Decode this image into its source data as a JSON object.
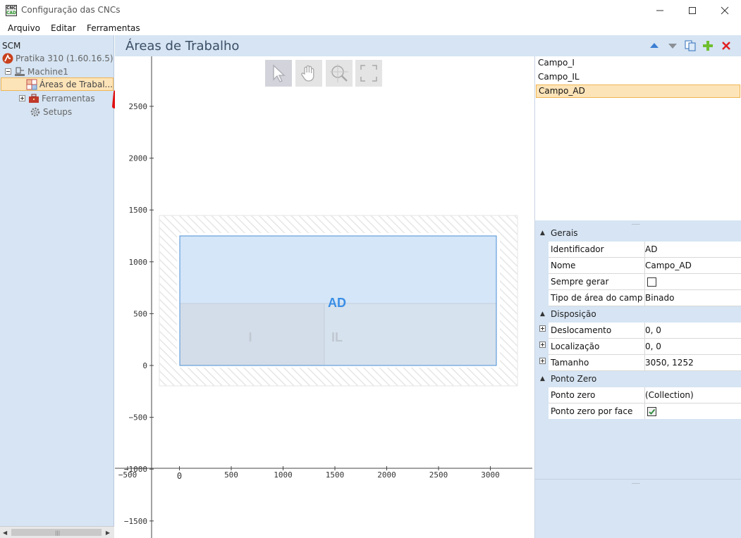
{
  "window": {
    "title": "Configuração das CNCs",
    "icon_text_top": "CNC",
    "icon_text_bottom": "CAD"
  },
  "menu": {
    "items": [
      "Arquivo",
      "Editar",
      "Ferramentas"
    ]
  },
  "tree": {
    "root": "SCM",
    "machine_model": "Pratika 310 (1.60.16.5)",
    "machine": "Machine1",
    "items": [
      {
        "label": "Áreas de Trabal...",
        "selected": true,
        "icon": "grid-icon"
      },
      {
        "label": "Ferramentas",
        "selected": false,
        "icon": "toolbox-icon"
      },
      {
        "label": "Setups",
        "selected": false,
        "icon": "gear-icon"
      }
    ]
  },
  "header": {
    "title": "Áreas de Trabalho",
    "buttons": [
      "move-up-icon",
      "move-down-icon",
      "copy-icon",
      "add-icon",
      "delete-icon"
    ]
  },
  "toolbar": {
    "tools": [
      "select-pointer-icon",
      "pan-hand-icon",
      "zoom-icon",
      "fit-view-icon"
    ],
    "active": "select-pointer-icon"
  },
  "plot": {
    "y_ticks": [
      "2500",
      "2000",
      "1500",
      "1000",
      "500",
      "0",
      "−500",
      "−1000",
      "−1500"
    ],
    "x_ticks": [
      "−500",
      "0",
      "500",
      "1000",
      "1500",
      "2000",
      "2500",
      "3000"
    ],
    "areas": {
      "main_label": "AD",
      "left_label": "I",
      "right_label": "IL"
    },
    "colors": {
      "area_fill": "#d4e6f8",
      "area_border": "#4b8fd6",
      "label_main": "#3a8ee6",
      "label_sub": "#c0c8d2"
    }
  },
  "list": {
    "items": [
      "Campo_I",
      "Campo_IL",
      "Campo_AD"
    ],
    "selected_index": 2
  },
  "properties": {
    "categories": [
      {
        "label": "Gerais",
        "rows": [
          {
            "name": "Identificador",
            "value": "AD"
          },
          {
            "name": "Nome",
            "value": "Campo_AD"
          },
          {
            "name": "Sempre gerar",
            "value": "",
            "checkbox": false
          },
          {
            "name": "Tipo de área do campo...",
            "value": "Binado"
          }
        ]
      },
      {
        "label": "Disposição",
        "rows": [
          {
            "name": "Deslocamento",
            "value": "0, 0",
            "expandable": true
          },
          {
            "name": "Localização",
            "value": "0, 0",
            "expandable": true
          },
          {
            "name": "Tamanho",
            "value": "3050, 1252",
            "expandable": true
          }
        ]
      },
      {
        "label": "Ponto Zero",
        "rows": [
          {
            "name": "Ponto zero",
            "value": "(Collection)"
          },
          {
            "name": "Ponto zero por face",
            "value": "",
            "checkbox": true
          }
        ]
      }
    ]
  }
}
